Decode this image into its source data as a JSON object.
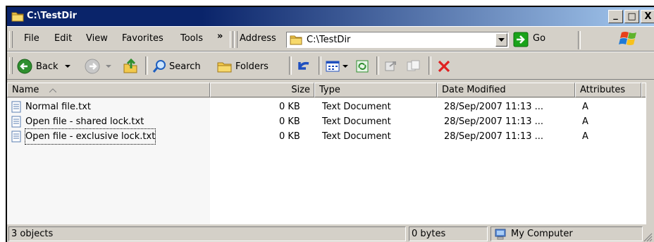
{
  "window": {
    "title": "C:\\TestDir"
  },
  "titlebar_buttons": {
    "minimize": "_",
    "maximize": "□",
    "close": "X"
  },
  "menu": {
    "file": "File",
    "edit": "Edit",
    "view": "View",
    "favorites": "Favorites",
    "tools": "Tools",
    "chevron": "»"
  },
  "address": {
    "label": "Address",
    "value": "C:\\TestDir",
    "go_label": "Go"
  },
  "toolbar": {
    "back": "Back",
    "search": "Search",
    "folders": "Folders"
  },
  "columns": {
    "name": "Name",
    "size": "Size",
    "type": "Type",
    "modified": "Date Modified",
    "attributes": "Attributes"
  },
  "files": [
    {
      "name": "Normal file.txt",
      "size": "0 KB",
      "type": "Text Document",
      "modified": "28/Sep/2007 11:13 ...",
      "attributes": "A"
    },
    {
      "name": "Open file - shared lock.txt",
      "size": "0 KB",
      "type": "Text Document",
      "modified": "28/Sep/2007 11:13 ...",
      "attributes": "A"
    },
    {
      "name": "Open file - exclusive lock.txt",
      "size": "0 KB",
      "type": "Text Document",
      "modified": "28/Sep/2007 11:13 ...",
      "attributes": "A"
    }
  ],
  "status": {
    "objects": "3 objects",
    "bytes": "0 bytes",
    "zone": "My Computer"
  },
  "colors": {
    "title_start": "#0a246a",
    "title_end": "#a6caf0",
    "chrome": "#d4d0c8",
    "delete_red": "#e02020",
    "go_green": "#1aa31a"
  }
}
